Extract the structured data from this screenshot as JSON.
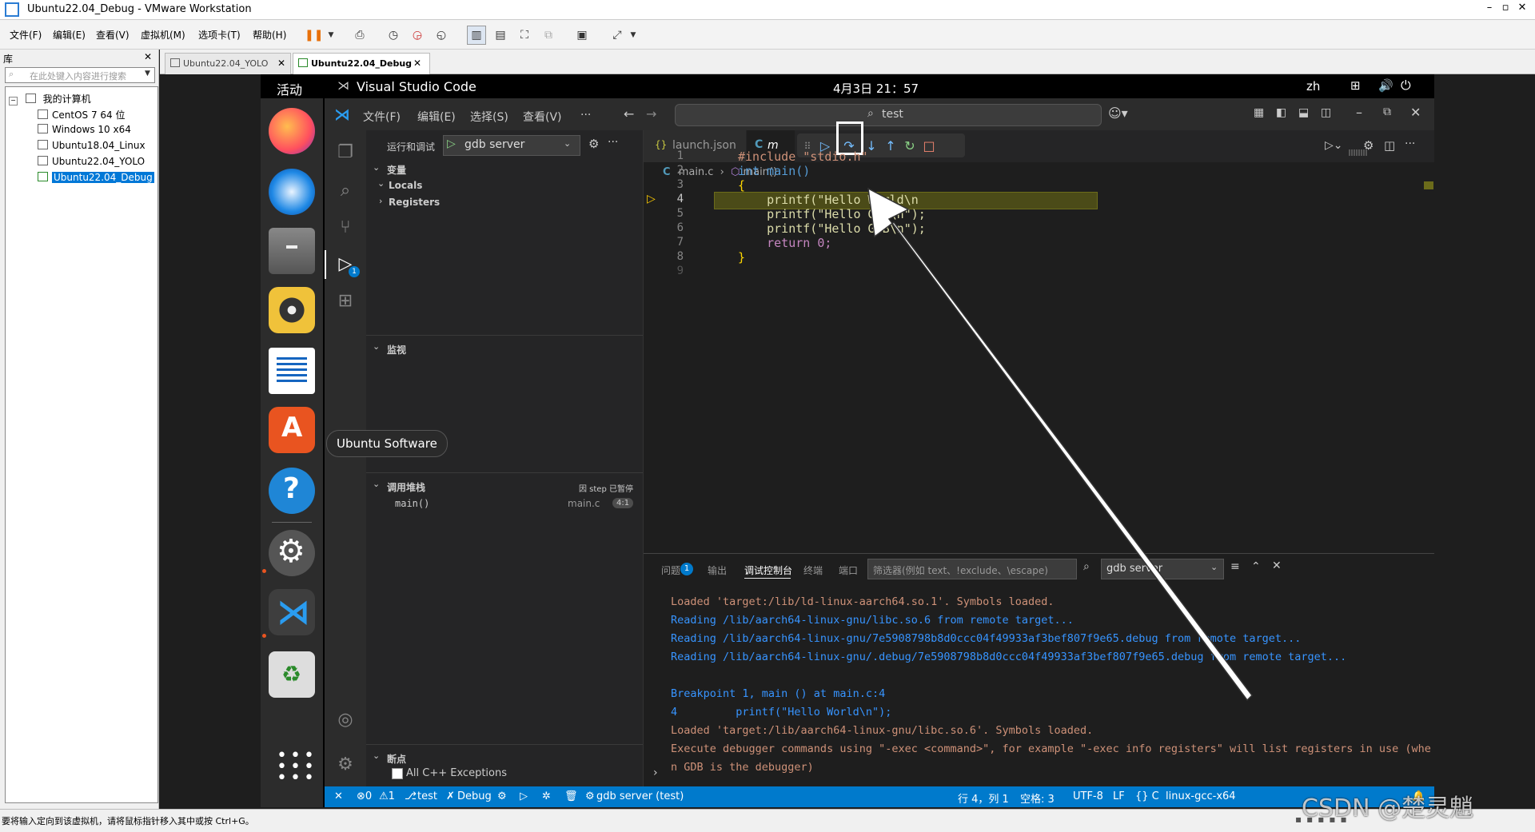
{
  "vm": {
    "title": "Ubuntu22.04_Debug - VMware Workstation",
    "menus": [
      "文件(F)",
      "编辑(E)",
      "查看(V)",
      "虚拟机(M)",
      "选项卡(T)",
      "帮助(H)"
    ],
    "library_title": "库",
    "library_search_placeholder": "在此处键入内容进行搜索",
    "tree_root": "我的计算机",
    "vms": [
      "CentOS 7 64 位",
      "Windows 10 x64",
      "Ubuntu18.04_Linux",
      "Ubuntu22.04_YOLO",
      "Ubuntu22.04_Debug"
    ],
    "tabs": [
      "Ubuntu22.04_YOLO",
      "Ubuntu22.04_Debug"
    ],
    "status_text": "要将输入定向到该虚拟机，请将鼠标指针移入其中或按 Ctrl+G。",
    "watermark": "CSDN @楚灵魈"
  },
  "gnome": {
    "activities": "活动",
    "app_name": "Visual Studio Code",
    "clock": "4月3日  21：57",
    "input_method": "zh",
    "tooltip": "Ubuntu Software"
  },
  "vscode": {
    "menus": [
      "文件(F)",
      "编辑(E)",
      "选择(S)",
      "查看(V)",
      "···"
    ],
    "command_center": "test",
    "run_debug_label": "运行和调试",
    "launch_config": "gdb server",
    "variables_header": "变量",
    "locals": "Locals",
    "registers": "Registers",
    "watch_header": "监视",
    "callstack_header": "调用堆栈",
    "callstack_status": "因 step 已暂停",
    "frame_name": "main()",
    "frame_file": "main.c",
    "frame_pos": "4:1",
    "breakpoints_header": "断点",
    "bp_cpp_exceptions": "All C++ Exceptions",
    "tab_launch": "launch.json",
    "tab_main_prefix": "C",
    "tab_main_text": "m",
    "breadcrumb_file": "main.c",
    "breadcrumb_func": "main()",
    "breadcrumb_lang": "C",
    "code": [
      {
        "n": "1",
        "text": "#include \"stdio.h\""
      },
      {
        "n": "2",
        "text": "int main()"
      },
      {
        "n": "3",
        "text": "{"
      },
      {
        "n": "4",
        "text": "    printf(\"Hello World\\n"
      },
      {
        "n": "5",
        "text": "    printf(\"Hello GCC\\n\");"
      },
      {
        "n": "6",
        "text": "    printf(\"Hello GDB\\n\");"
      },
      {
        "n": "7",
        "text": "    return 0;"
      },
      {
        "n": "8",
        "text": "}"
      },
      {
        "n": "9",
        "text": ""
      }
    ],
    "panel_tabs": [
      "问题",
      "输出",
      "调试控制台",
      "终端",
      "端口"
    ],
    "problems_count": "1",
    "filter_placeholder": "筛选器(例如 text、!exclude、\\escape)",
    "panel_config": "gdb server",
    "output": [
      {
        "text": "Loaded 'target:/lib/ld-linux-aarch64.so.1'. Symbols loaded.",
        "color": "#ce9178"
      },
      {
        "text": "Reading /lib/aarch64-linux-gnu/libc.so.6 from remote target...",
        "color": "#3794ff"
      },
      {
        "text": "Reading /lib/aarch64-linux-gnu/7e5908798b8d0ccc04f49933af3bef807f9e65.debug from remote target...",
        "color": "#3794ff"
      },
      {
        "text": "Reading /lib/aarch64-linux-gnu/.debug/7e5908798b8d0ccc04f49933af3bef807f9e65.debug from remote target...",
        "color": "#3794ff"
      },
      {
        "text": "",
        "color": "#3794ff"
      },
      {
        "text": "Breakpoint 1, main () at main.c:4",
        "color": "#3794ff"
      },
      {
        "text": "4         printf(\"Hello World\\n\");",
        "color": "#3794ff"
      },
      {
        "text": "Loaded 'target:/lib/aarch64-linux-gnu/libc.so.6'. Symbols loaded.",
        "color": "#ce9178"
      },
      {
        "text": "Execute debugger commands using \"-exec <command>\", for example \"-exec info registers\" will list registers in use (whe",
        "color": "#ce9178"
      },
      {
        "text": "n GDB is the debugger)",
        "color": "#ce9178"
      }
    ],
    "status": {
      "errors": "⊗0",
      "warnings": "⚠1",
      "branch": "test",
      "debug": "Debug",
      "target": "gdb server (test)",
      "position": "行 4，列 1",
      "spaces": "空格: 3",
      "encoding": "UTF-8",
      "eol": "LF",
      "lang": "{} C",
      "platform": "linux-gcc-x64"
    }
  }
}
